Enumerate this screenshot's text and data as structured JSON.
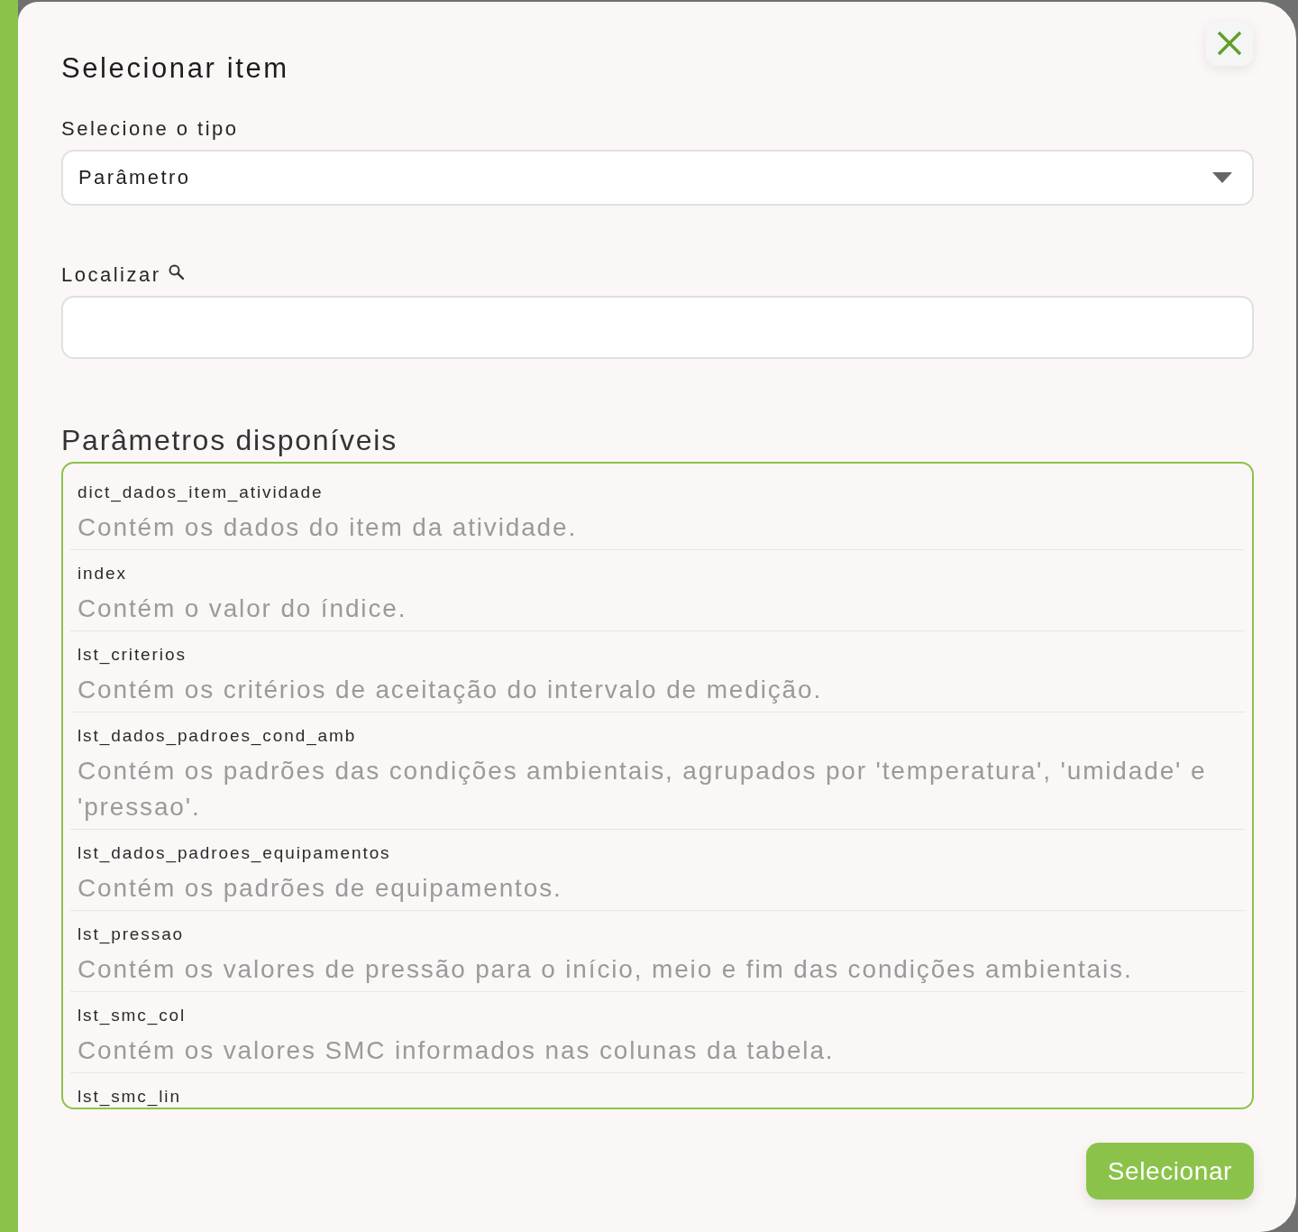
{
  "dialog": {
    "title": "Selecionar item",
    "fields": [
      {
        "kind": "select",
        "label": "Selecione o tipo",
        "value": "Parâmetro"
      },
      {
        "kind": "search",
        "label": "Localizar"
      }
    ],
    "list": {
      "title": "Parâmetros disponíveis",
      "items": [
        {
          "name": "dict_dados_item_atividade",
          "description": "Contém os dados do item da atividade."
        },
        {
          "name": "index",
          "description": "Contém o valor do índice."
        },
        {
          "name": "lst_criterios",
          "description": "Contém os critérios de aceitação do intervalo de medição."
        },
        {
          "name": "lst_dados_padroes_cond_amb",
          "description": "Contém os padrões das condições ambientais, agrupados por 'temperatura', 'umidade' e 'pressao'."
        },
        {
          "name": "lst_dados_padroes_equipamentos",
          "description": "Contém os padrões de equipamentos."
        },
        {
          "name": "lst_pressao",
          "description": "Contém os valores de pressão para o início, meio e fim das condições ambientais."
        },
        {
          "name": "lst_smc_col",
          "description": "Contém os valores SMC informados nas colunas da tabela."
        },
        {
          "name": "lst_smc_lin"
        }
      ]
    },
    "buttons": [
      {
        "label": "Selecionar"
      }
    ]
  }
}
